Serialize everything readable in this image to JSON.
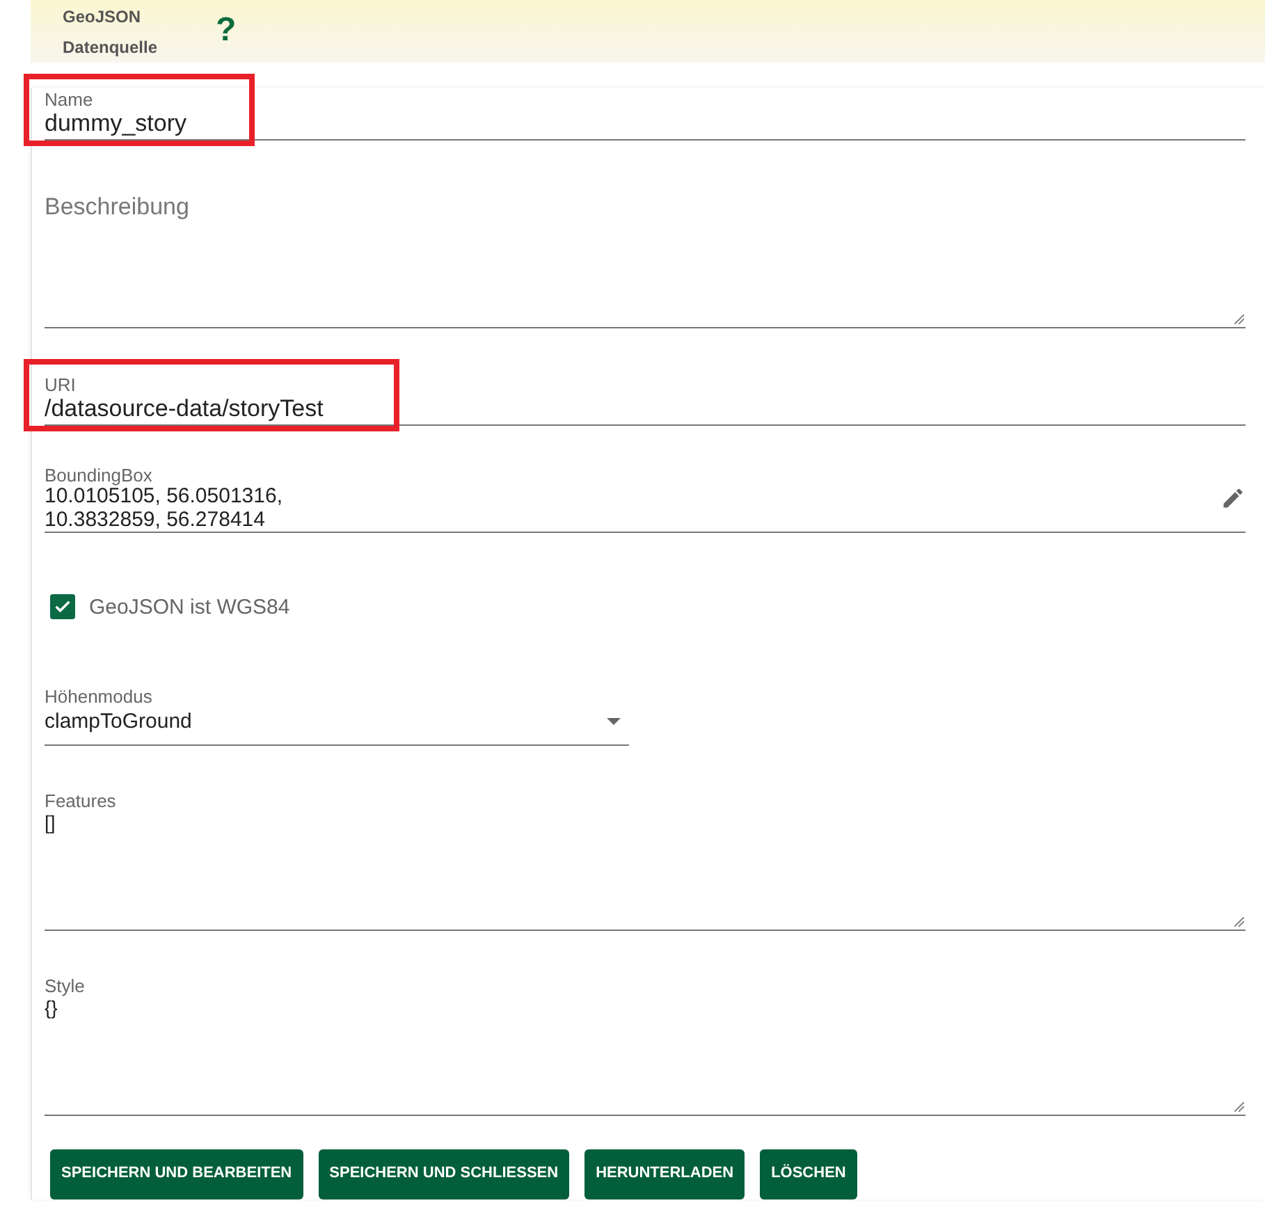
{
  "header": {
    "title_line_1": "GeoJSON",
    "title_line_2": "Datenquelle",
    "help": "?"
  },
  "fields": [
    {
      "kind": "text",
      "label": "Name",
      "value": "dummy_story",
      "highlighted": true
    },
    {
      "kind": "textarea",
      "label": "Beschreibung"
    },
    {
      "kind": "text",
      "label": "URI",
      "value": "/datasource-data/storyTest",
      "highlighted": true
    },
    {
      "kind": "bbox",
      "label": "BoundingBox",
      "value_line_1": "10.0105105, 56.0501316,",
      "value_line_2": "10.3832859, 56.278414"
    },
    {
      "kind": "checkbox",
      "label": "GeoJSON ist WGS84",
      "checked": true
    },
    {
      "kind": "select",
      "label": "Höhenmodus",
      "value": "clampToGround"
    },
    {
      "kind": "textarea",
      "label": "Features",
      "value": "[]"
    },
    {
      "kind": "textarea",
      "label": "Style",
      "value": "{}"
    }
  ],
  "buttons": [
    "SPEICHERN UND BEARBEITEN",
    "SPEICHERN UND SCHLIESSEN",
    "HERUNTERLADEN",
    "LÖSCHEN"
  ]
}
